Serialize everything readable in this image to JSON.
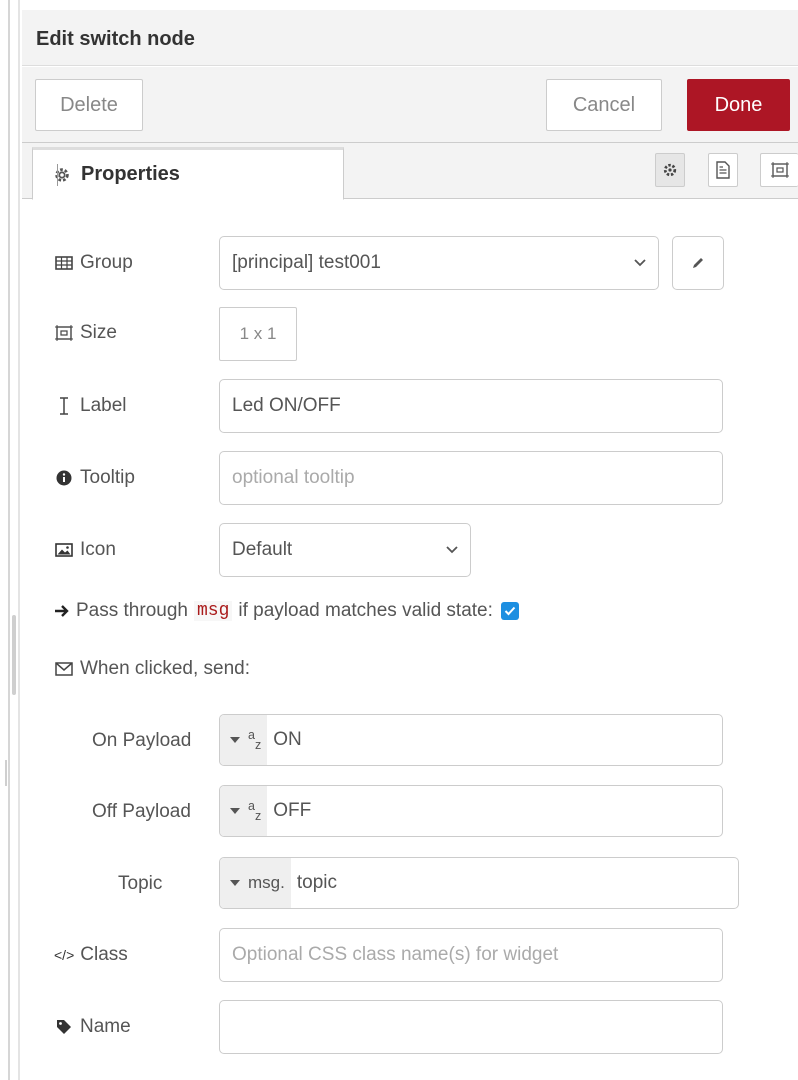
{
  "header": {
    "title": "Edit switch node"
  },
  "toolbar": {
    "delete_label": "Delete",
    "cancel_label": "Cancel",
    "done_label": "Done"
  },
  "tabs": [
    {
      "label": "Properties",
      "icon": "cog-icon"
    }
  ],
  "tab_buttons": [
    "cog-icon",
    "description-icon",
    "appearance-icon"
  ],
  "form": {
    "group": {
      "label": "Group",
      "value": "[principal] test001"
    },
    "size": {
      "label": "Size",
      "value": "1 x 1"
    },
    "label": {
      "label": "Label",
      "value": "Led ON/OFF"
    },
    "tooltip": {
      "label": "Tooltip",
      "placeholder": "optional tooltip"
    },
    "icon": {
      "label": "Icon",
      "value": "Default"
    },
    "pass_through": {
      "prefix": "Pass through",
      "code": "msg",
      "suffix": "if payload matches valid state:",
      "checked": true
    },
    "when_clicked": {
      "label": "When clicked, send:"
    },
    "on_payload": {
      "label": "On Payload",
      "type_glyph": "a",
      "type_glyph_sub": "z",
      "value": "ON"
    },
    "off_payload": {
      "label": "Off Payload",
      "type_glyph": "a",
      "type_glyph_sub": "z",
      "value": "OFF"
    },
    "topic": {
      "label": "Topic",
      "type": "msg.",
      "value": "topic"
    },
    "class": {
      "label": "Class",
      "icon_text": "</>",
      "placeholder": "Optional CSS class name(s) for widget"
    },
    "name": {
      "label": "Name",
      "value": ""
    }
  },
  "colors": {
    "accent": "#ad1625",
    "checkbox": "#1d8fe1",
    "code": "#aa1b1b"
  }
}
